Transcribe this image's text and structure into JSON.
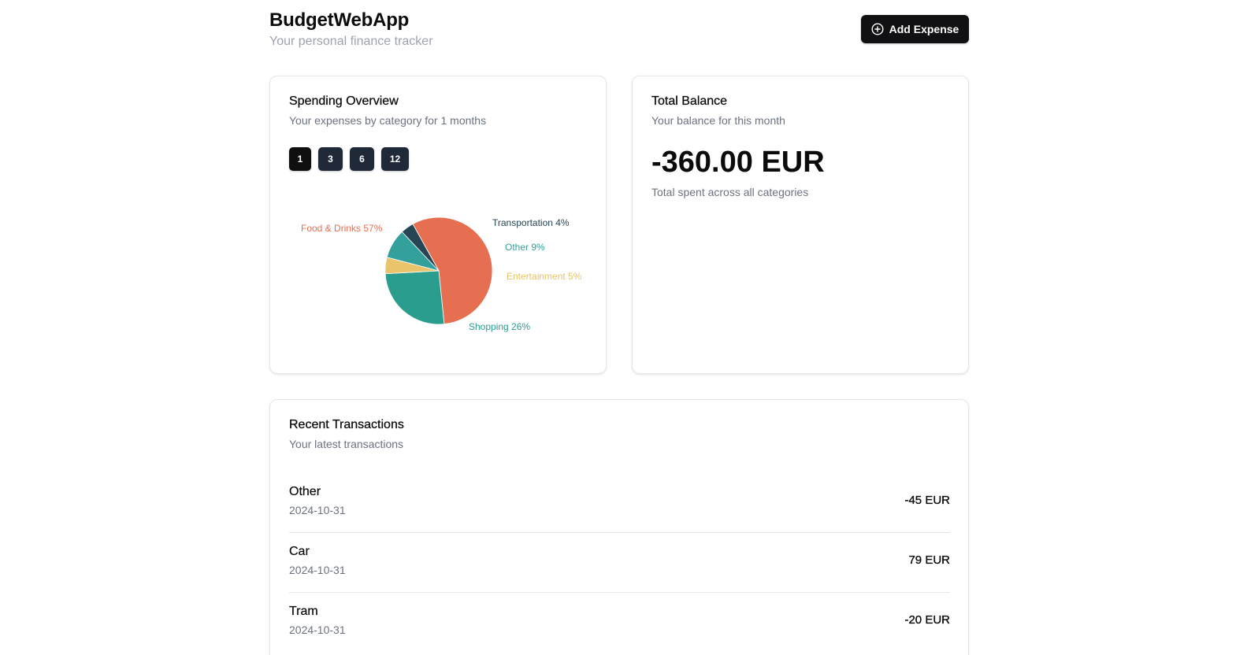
{
  "header": {
    "title": "BudgetWebApp",
    "subtitle": "Your personal finance tracker",
    "add_button_label": "Add Expense",
    "add_button_icon": "plus-circle-icon"
  },
  "spending": {
    "title": "Spending Overview",
    "description": "Your expenses by category for 1 months",
    "periods": [
      "1",
      "3",
      "6",
      "12"
    ],
    "selected_period": "1"
  },
  "chart_data": {
    "type": "pie",
    "title": "",
    "slices": [
      {
        "label": "Food & Drinks 57%",
        "category": "Food & Drinks",
        "value": 57,
        "color": "#e76f51"
      },
      {
        "label": "Shopping 26%",
        "category": "Shopping",
        "value": 26,
        "color": "#2a9d8f"
      },
      {
        "label": "Entertainment 5%",
        "category": "Entertainment",
        "value": 5,
        "color": "#e9c46a"
      },
      {
        "label": "Other 9%",
        "category": "Other",
        "value": 9,
        "color": "#34a09c"
      },
      {
        "label": "Transportation 4%",
        "category": "Transportation",
        "value": 4,
        "color": "#264653"
      }
    ]
  },
  "balance": {
    "title": "Total Balance",
    "description": "Your balance for this month",
    "amount": "-360.00 EUR",
    "note": "Total spent across all categories"
  },
  "transactions": {
    "title": "Recent Transactions",
    "description": "Your latest transactions",
    "items": [
      {
        "name": "Other",
        "date": "2024-10-31",
        "amount": "-45 EUR"
      },
      {
        "name": "Car",
        "date": "2024-10-31",
        "amount": "79 EUR"
      },
      {
        "name": "Tram",
        "date": "2024-10-31",
        "amount": "-20 EUR"
      }
    ]
  }
}
